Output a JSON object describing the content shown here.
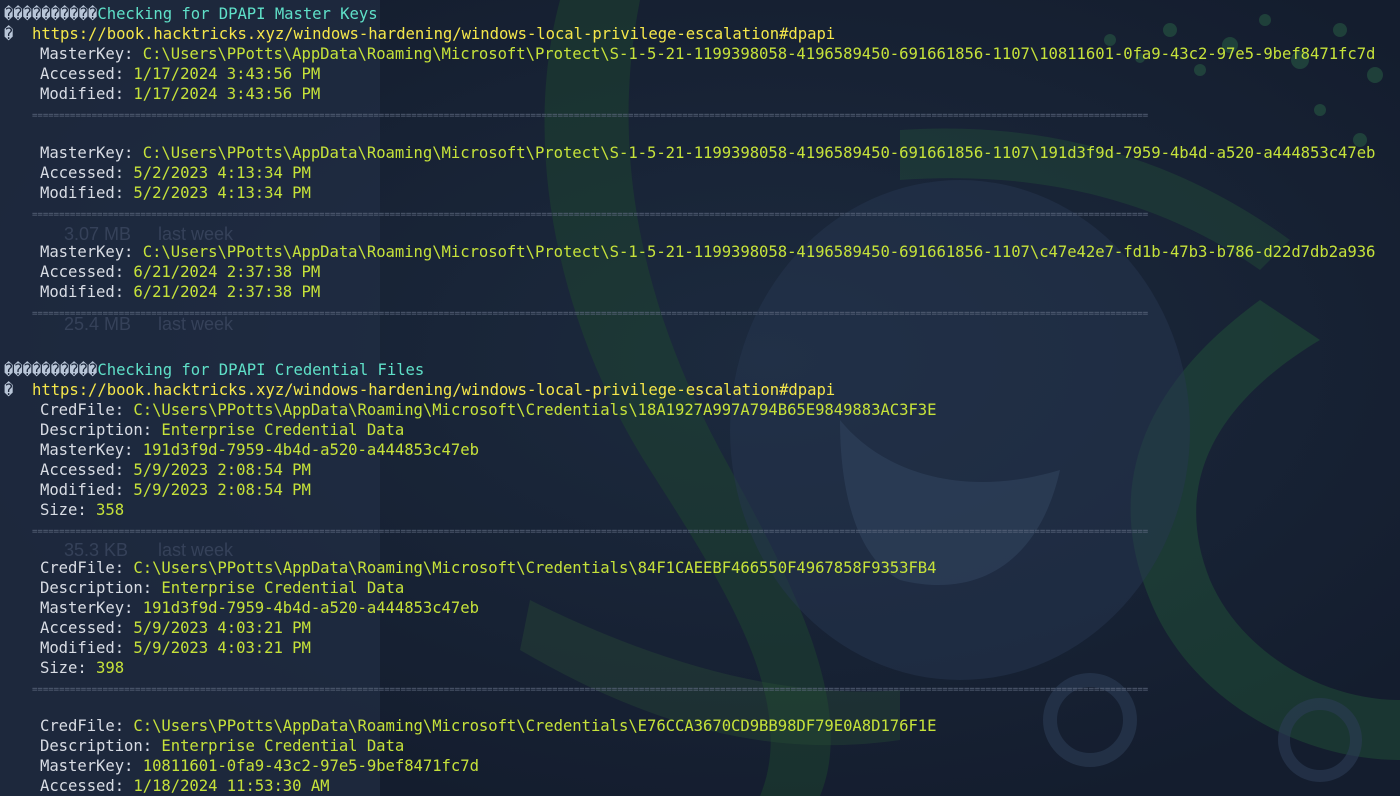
{
  "background": {
    "ghost_texts": [
      "3.07 MB",
      "last week",
      "25.4 MB",
      "last week",
      "35.3 KB",
      "last week"
    ]
  },
  "colors": {
    "bg": "#172236",
    "key": "#d8dce4",
    "value": "#c6e23a",
    "url": "#f5e74a",
    "header": "#5fe0c8"
  },
  "masterkeys": {
    "header_prefix": "����������",
    "header_text": "Checking for DPAPI Master Keys",
    "url_marker": "�",
    "url": "https://book.hacktricks.xyz/windows-hardening/windows-local-privilege-escalation#dpapi",
    "separator": "==============================================================================================================================================================================================================",
    "entries": [
      {
        "masterkey_label": "MasterKey:",
        "masterkey": "C:\\Users\\PPotts\\AppData\\Roaming\\Microsoft\\Protect\\S-1-5-21-1199398058-4196589450-691661856-1107\\10811601-0fa9-43c2-97e5-9bef8471fc7d",
        "accessed_label": "Accessed:",
        "accessed": "1/17/2024 3:43:56 PM",
        "modified_label": "Modified:",
        "modified": "1/17/2024 3:43:56 PM"
      },
      {
        "masterkey_label": "MasterKey:",
        "masterkey": "C:\\Users\\PPotts\\AppData\\Roaming\\Microsoft\\Protect\\S-1-5-21-1199398058-4196589450-691661856-1107\\191d3f9d-7959-4b4d-a520-a444853c47eb",
        "accessed_label": "Accessed:",
        "accessed": "5/2/2023 4:13:34 PM",
        "modified_label": "Modified:",
        "modified": "5/2/2023 4:13:34 PM"
      },
      {
        "masterkey_label": "MasterKey:",
        "masterkey": "C:\\Users\\PPotts\\AppData\\Roaming\\Microsoft\\Protect\\S-1-5-21-1199398058-4196589450-691661856-1107\\c47e42e7-fd1b-47b3-b786-d22d7db2a936",
        "accessed_label": "Accessed:",
        "accessed": "6/21/2024 2:37:38 PM",
        "modified_label": "Modified:",
        "modified": "6/21/2024 2:37:38 PM"
      }
    ]
  },
  "credfiles": {
    "header_prefix": "����������",
    "header_text": "Checking for DPAPI Credential Files",
    "url_marker": "�",
    "url": "https://book.hacktricks.xyz/windows-hardening/windows-local-privilege-escalation#dpapi",
    "entries": [
      {
        "credfile_label": "CredFile:",
        "credfile": "C:\\Users\\PPotts\\AppData\\Roaming\\Microsoft\\Credentials\\18A1927A997A794B65E9849883AC3F3E",
        "description_label": "Description:",
        "description": "Enterprise Credential Data",
        "masterkey_label": "MasterKey:",
        "masterkey": "191d3f9d-7959-4b4d-a520-a444853c47eb",
        "accessed_label": "Accessed:",
        "accessed": "5/9/2023 2:08:54 PM",
        "modified_label": "Modified:",
        "modified": "5/9/2023 2:08:54 PM",
        "size_label": "Size:",
        "size": "358"
      },
      {
        "credfile_label": "CredFile:",
        "credfile": "C:\\Users\\PPotts\\AppData\\Roaming\\Microsoft\\Credentials\\84F1CAEEBF466550F4967858F9353FB4",
        "description_label": "Description:",
        "description": "Enterprise Credential Data",
        "masterkey_label": "MasterKey:",
        "masterkey": "191d3f9d-7959-4b4d-a520-a444853c47eb",
        "accessed_label": "Accessed:",
        "accessed": "5/9/2023 4:03:21 PM",
        "modified_label": "Modified:",
        "modified": "5/9/2023 4:03:21 PM",
        "size_label": "Size:",
        "size": "398"
      },
      {
        "credfile_label": "CredFile:",
        "credfile": "C:\\Users\\PPotts\\AppData\\Roaming\\Microsoft\\Credentials\\E76CCA3670CD9BB98DF79E0A8D176F1E",
        "description_label": "Description:",
        "description": "Enterprise Credential Data",
        "masterkey_label": "MasterKey:",
        "masterkey": "10811601-0fa9-43c2-97e5-9bef8471fc7d",
        "accessed_label": "Accessed:",
        "accessed": "1/18/2024 11:53:30 AM"
      }
    ]
  }
}
